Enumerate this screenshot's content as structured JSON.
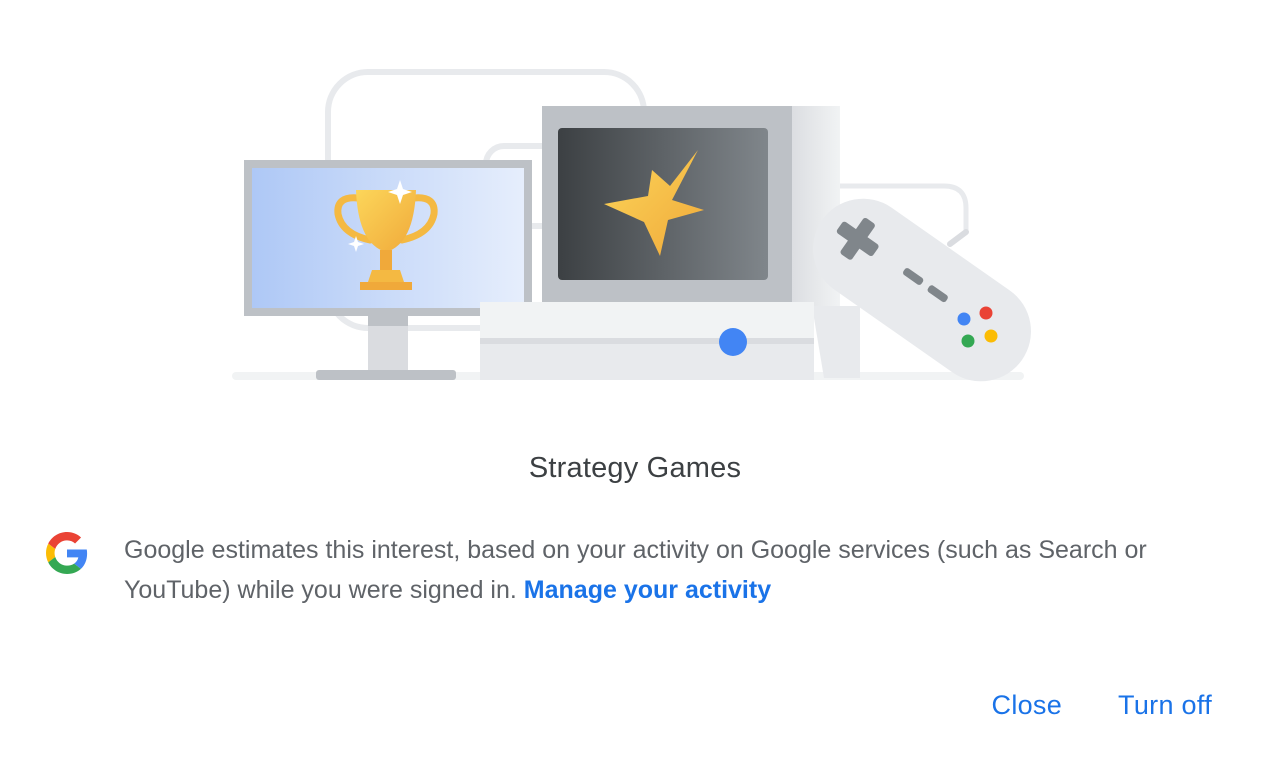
{
  "dialog": {
    "title": "Strategy Games",
    "info": {
      "text": "Google estimates this interest, based on your activity on Google services (such as Search or YouTube) while you were signed in.",
      "link_label": "Manage your activity"
    },
    "actions": {
      "close_label": "Close",
      "turn_off_label": "Turn off"
    }
  },
  "icons": {
    "google_logo": "google-g-icon",
    "trophy": "trophy-icon",
    "star": "star-icon",
    "controller": "game-controller-icon"
  },
  "colors": {
    "link": "#1a73e8",
    "title": "#3c4043",
    "body_text": "#5f6368",
    "google_blue": "#4285f4",
    "google_red": "#ea4335",
    "google_yellow": "#fbbc04",
    "google_green": "#34a853",
    "trophy_gold": "#f4b942"
  }
}
